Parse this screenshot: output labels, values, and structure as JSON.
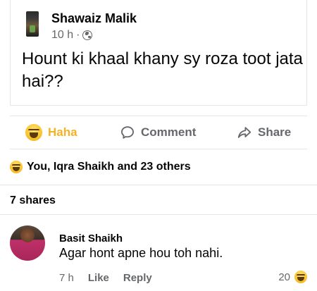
{
  "post": {
    "author": "Shawaiz Malik",
    "time": "10 h",
    "separator": "·",
    "text": "Hount ki khaal khany sy roza toot jata hai??"
  },
  "actions": {
    "haha": "Haha",
    "comment": "Comment",
    "share": "Share"
  },
  "reactions_summary": "You, Iqra Shaikh and 23 others",
  "shares": "7 shares",
  "comment": {
    "author": "Basit Shaikh",
    "text": "Agar hont apne hou toh nahi.",
    "time": "7 h",
    "like": "Like",
    "reply": "Reply",
    "reaction_count": "20"
  },
  "icons": {
    "privacy": "globe-icon",
    "haha": "haha-emoji-icon",
    "comment": "comment-bubble-icon",
    "share": "share-arrow-icon"
  },
  "colors": {
    "haha_accent": "#f7b125",
    "secondary_text": "#65676b",
    "divider": "#e4e6eb"
  }
}
